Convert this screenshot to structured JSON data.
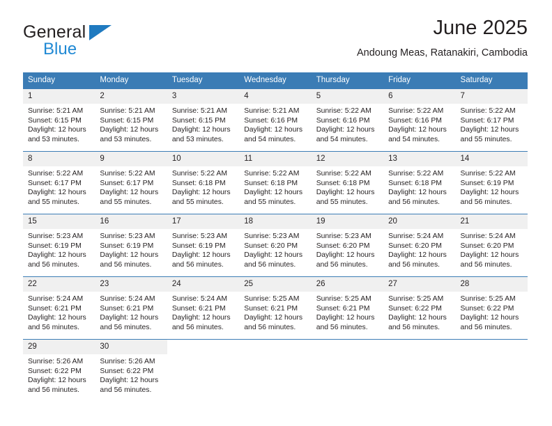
{
  "brand": {
    "name_top": "General",
    "name_bottom": "Blue"
  },
  "header": {
    "title": "June 2025",
    "subtitle": "Andoung Meas, Ratanakiri, Cambodia"
  },
  "colors": {
    "header_blue": "#3b7cb5",
    "brand_blue": "#2089d4",
    "daynum_bg": "#f0f0f0",
    "text": "#231f20"
  },
  "weekdays": [
    "Sunday",
    "Monday",
    "Tuesday",
    "Wednesday",
    "Thursday",
    "Friday",
    "Saturday"
  ],
  "labels": {
    "sunrise_prefix": "Sunrise:",
    "sunset_prefix": "Sunset:",
    "daylight_prefix": "Daylight:"
  },
  "weeks": [
    [
      {
        "day": "1",
        "sunrise": "Sunrise: 5:21 AM",
        "sunset": "Sunset: 6:15 PM",
        "daylight_1": "Daylight: 12 hours",
        "daylight_2": "and 53 minutes."
      },
      {
        "day": "2",
        "sunrise": "Sunrise: 5:21 AM",
        "sunset": "Sunset: 6:15 PM",
        "daylight_1": "Daylight: 12 hours",
        "daylight_2": "and 53 minutes."
      },
      {
        "day": "3",
        "sunrise": "Sunrise: 5:21 AM",
        "sunset": "Sunset: 6:15 PM",
        "daylight_1": "Daylight: 12 hours",
        "daylight_2": "and 53 minutes."
      },
      {
        "day": "4",
        "sunrise": "Sunrise: 5:21 AM",
        "sunset": "Sunset: 6:16 PM",
        "daylight_1": "Daylight: 12 hours",
        "daylight_2": "and 54 minutes."
      },
      {
        "day": "5",
        "sunrise": "Sunrise: 5:22 AM",
        "sunset": "Sunset: 6:16 PM",
        "daylight_1": "Daylight: 12 hours",
        "daylight_2": "and 54 minutes."
      },
      {
        "day": "6",
        "sunrise": "Sunrise: 5:22 AM",
        "sunset": "Sunset: 6:16 PM",
        "daylight_1": "Daylight: 12 hours",
        "daylight_2": "and 54 minutes."
      },
      {
        "day": "7",
        "sunrise": "Sunrise: 5:22 AM",
        "sunset": "Sunset: 6:17 PM",
        "daylight_1": "Daylight: 12 hours",
        "daylight_2": "and 55 minutes."
      }
    ],
    [
      {
        "day": "8",
        "sunrise": "Sunrise: 5:22 AM",
        "sunset": "Sunset: 6:17 PM",
        "daylight_1": "Daylight: 12 hours",
        "daylight_2": "and 55 minutes."
      },
      {
        "day": "9",
        "sunrise": "Sunrise: 5:22 AM",
        "sunset": "Sunset: 6:17 PM",
        "daylight_1": "Daylight: 12 hours",
        "daylight_2": "and 55 minutes."
      },
      {
        "day": "10",
        "sunrise": "Sunrise: 5:22 AM",
        "sunset": "Sunset: 6:18 PM",
        "daylight_1": "Daylight: 12 hours",
        "daylight_2": "and 55 minutes."
      },
      {
        "day": "11",
        "sunrise": "Sunrise: 5:22 AM",
        "sunset": "Sunset: 6:18 PM",
        "daylight_1": "Daylight: 12 hours",
        "daylight_2": "and 55 minutes."
      },
      {
        "day": "12",
        "sunrise": "Sunrise: 5:22 AM",
        "sunset": "Sunset: 6:18 PM",
        "daylight_1": "Daylight: 12 hours",
        "daylight_2": "and 55 minutes."
      },
      {
        "day": "13",
        "sunrise": "Sunrise: 5:22 AM",
        "sunset": "Sunset: 6:18 PM",
        "daylight_1": "Daylight: 12 hours",
        "daylight_2": "and 56 minutes."
      },
      {
        "day": "14",
        "sunrise": "Sunrise: 5:22 AM",
        "sunset": "Sunset: 6:19 PM",
        "daylight_1": "Daylight: 12 hours",
        "daylight_2": "and 56 minutes."
      }
    ],
    [
      {
        "day": "15",
        "sunrise": "Sunrise: 5:23 AM",
        "sunset": "Sunset: 6:19 PM",
        "daylight_1": "Daylight: 12 hours",
        "daylight_2": "and 56 minutes."
      },
      {
        "day": "16",
        "sunrise": "Sunrise: 5:23 AM",
        "sunset": "Sunset: 6:19 PM",
        "daylight_1": "Daylight: 12 hours",
        "daylight_2": "and 56 minutes."
      },
      {
        "day": "17",
        "sunrise": "Sunrise: 5:23 AM",
        "sunset": "Sunset: 6:19 PM",
        "daylight_1": "Daylight: 12 hours",
        "daylight_2": "and 56 minutes."
      },
      {
        "day": "18",
        "sunrise": "Sunrise: 5:23 AM",
        "sunset": "Sunset: 6:20 PM",
        "daylight_1": "Daylight: 12 hours",
        "daylight_2": "and 56 minutes."
      },
      {
        "day": "19",
        "sunrise": "Sunrise: 5:23 AM",
        "sunset": "Sunset: 6:20 PM",
        "daylight_1": "Daylight: 12 hours",
        "daylight_2": "and 56 minutes."
      },
      {
        "day": "20",
        "sunrise": "Sunrise: 5:24 AM",
        "sunset": "Sunset: 6:20 PM",
        "daylight_1": "Daylight: 12 hours",
        "daylight_2": "and 56 minutes."
      },
      {
        "day": "21",
        "sunrise": "Sunrise: 5:24 AM",
        "sunset": "Sunset: 6:20 PM",
        "daylight_1": "Daylight: 12 hours",
        "daylight_2": "and 56 minutes."
      }
    ],
    [
      {
        "day": "22",
        "sunrise": "Sunrise: 5:24 AM",
        "sunset": "Sunset: 6:21 PM",
        "daylight_1": "Daylight: 12 hours",
        "daylight_2": "and 56 minutes."
      },
      {
        "day": "23",
        "sunrise": "Sunrise: 5:24 AM",
        "sunset": "Sunset: 6:21 PM",
        "daylight_1": "Daylight: 12 hours",
        "daylight_2": "and 56 minutes."
      },
      {
        "day": "24",
        "sunrise": "Sunrise: 5:24 AM",
        "sunset": "Sunset: 6:21 PM",
        "daylight_1": "Daylight: 12 hours",
        "daylight_2": "and 56 minutes."
      },
      {
        "day": "25",
        "sunrise": "Sunrise: 5:25 AM",
        "sunset": "Sunset: 6:21 PM",
        "daylight_1": "Daylight: 12 hours",
        "daylight_2": "and 56 minutes."
      },
      {
        "day": "26",
        "sunrise": "Sunrise: 5:25 AM",
        "sunset": "Sunset: 6:21 PM",
        "daylight_1": "Daylight: 12 hours",
        "daylight_2": "and 56 minutes."
      },
      {
        "day": "27",
        "sunrise": "Sunrise: 5:25 AM",
        "sunset": "Sunset: 6:22 PM",
        "daylight_1": "Daylight: 12 hours",
        "daylight_2": "and 56 minutes."
      },
      {
        "day": "28",
        "sunrise": "Sunrise: 5:25 AM",
        "sunset": "Sunset: 6:22 PM",
        "daylight_1": "Daylight: 12 hours",
        "daylight_2": "and 56 minutes."
      }
    ],
    [
      {
        "day": "29",
        "sunrise": "Sunrise: 5:26 AM",
        "sunset": "Sunset: 6:22 PM",
        "daylight_1": "Daylight: 12 hours",
        "daylight_2": "and 56 minutes."
      },
      {
        "day": "30",
        "sunrise": "Sunrise: 5:26 AM",
        "sunset": "Sunset: 6:22 PM",
        "daylight_1": "Daylight: 12 hours",
        "daylight_2": "and 56 minutes."
      },
      {
        "day": "",
        "sunrise": "",
        "sunset": "",
        "daylight_1": "",
        "daylight_2": ""
      },
      {
        "day": "",
        "sunrise": "",
        "sunset": "",
        "daylight_1": "",
        "daylight_2": ""
      },
      {
        "day": "",
        "sunrise": "",
        "sunset": "",
        "daylight_1": "",
        "daylight_2": ""
      },
      {
        "day": "",
        "sunrise": "",
        "sunset": "",
        "daylight_1": "",
        "daylight_2": ""
      },
      {
        "day": "",
        "sunrise": "",
        "sunset": "",
        "daylight_1": "",
        "daylight_2": ""
      }
    ]
  ]
}
